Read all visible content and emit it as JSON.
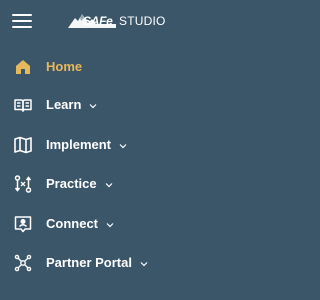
{
  "header": {
    "logo_brand": "SAFe",
    "logo_product": "STUDIO"
  },
  "colors": {
    "background": "#3c5669",
    "active": "#e6b85c",
    "text": "#ffffff"
  },
  "menu": [
    {
      "label": "Home",
      "icon": "home-icon",
      "active": true,
      "has_submenu": false
    },
    {
      "label": "Learn",
      "icon": "open-book-icon",
      "active": false,
      "has_submenu": true
    },
    {
      "label": "Implement",
      "icon": "map-icon",
      "active": false,
      "has_submenu": true
    },
    {
      "label": "Practice",
      "icon": "flow-connection-icon",
      "active": false,
      "has_submenu": true
    },
    {
      "label": "Connect",
      "icon": "contact-card-icon",
      "active": false,
      "has_submenu": true
    },
    {
      "label": "Partner Portal",
      "icon": "network-hub-icon",
      "active": false,
      "has_submenu": true
    }
  ]
}
